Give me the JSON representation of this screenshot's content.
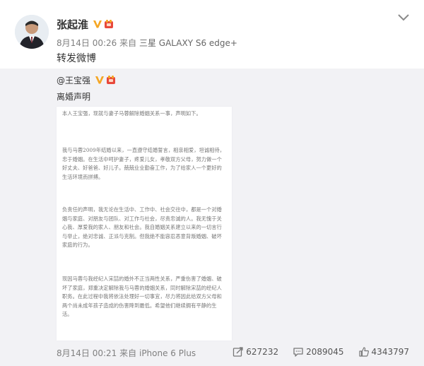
{
  "post": {
    "author": "张起淮",
    "timestamp": "8月14日 00:26",
    "source_prefix": "来自",
    "source_device": "三星 GALAXY S6 edge+",
    "text": "转发微博"
  },
  "repost": {
    "author": "@王宝强",
    "title": "离婚声明",
    "letter_paragraphs": [
      "本人王宝强，现就与妻子马蓉解除婚姻关系一事，声明如下。",
      "我与马蓉2009年结婚以来，一直遵守结婚誓言，相亲相爱，坦诚相待，忠于婚姻。在生活中呵护妻子，疼爱儿女，孝敬双方父母，努力做一个好丈夫、好爸爸、好儿子。兢兢业业勤奋工作，为了给家人一个更好的生活环境而拼搏。",
      "负责任的声明，我无论在生活中、工作中、社会交往中，都是一个对婚姻与家庭、对朋友与团队、对工作与社会，尽责忠诚的人。我无愧于关心我、厚爱我的家人、朋友和社会。我自婚姻关系建立以来的一切言行与举止，绝对忠诚、正派与克制。但我绝不能容忍恶意背叛婚姻、破坏家庭的行为。",
      "现因马蓉与我经纪人宋喆的婚外不正当两性关系，严重伤害了婚姻、破坏了家庭，郑重决定解除我与马蓉的婚姻关系，同时解除宋喆的经纪人职务。在此过程中我将依法处理好一切事宜，尽力将因此给双方父母和两个尚未成年孩子造成的伤害降到最低。希望他们继续拥有平静的生活。"
    ],
    "timestamp": "8月14日 00:21",
    "source_prefix": "来自",
    "source_device": "iPhone 6 Plus",
    "reposts": "627232",
    "comments": "2089045",
    "likes": "4343797"
  },
  "colors": {
    "repost_bg": "#f2f2f5",
    "verified_badge": "#f5a623",
    "vip_badge": "#e8483b",
    "meta_text": "#808080"
  },
  "icons": [
    "verified-v-icon",
    "vip-icon",
    "chevron-down-icon",
    "repost-icon",
    "comment-icon",
    "like-icon"
  ]
}
